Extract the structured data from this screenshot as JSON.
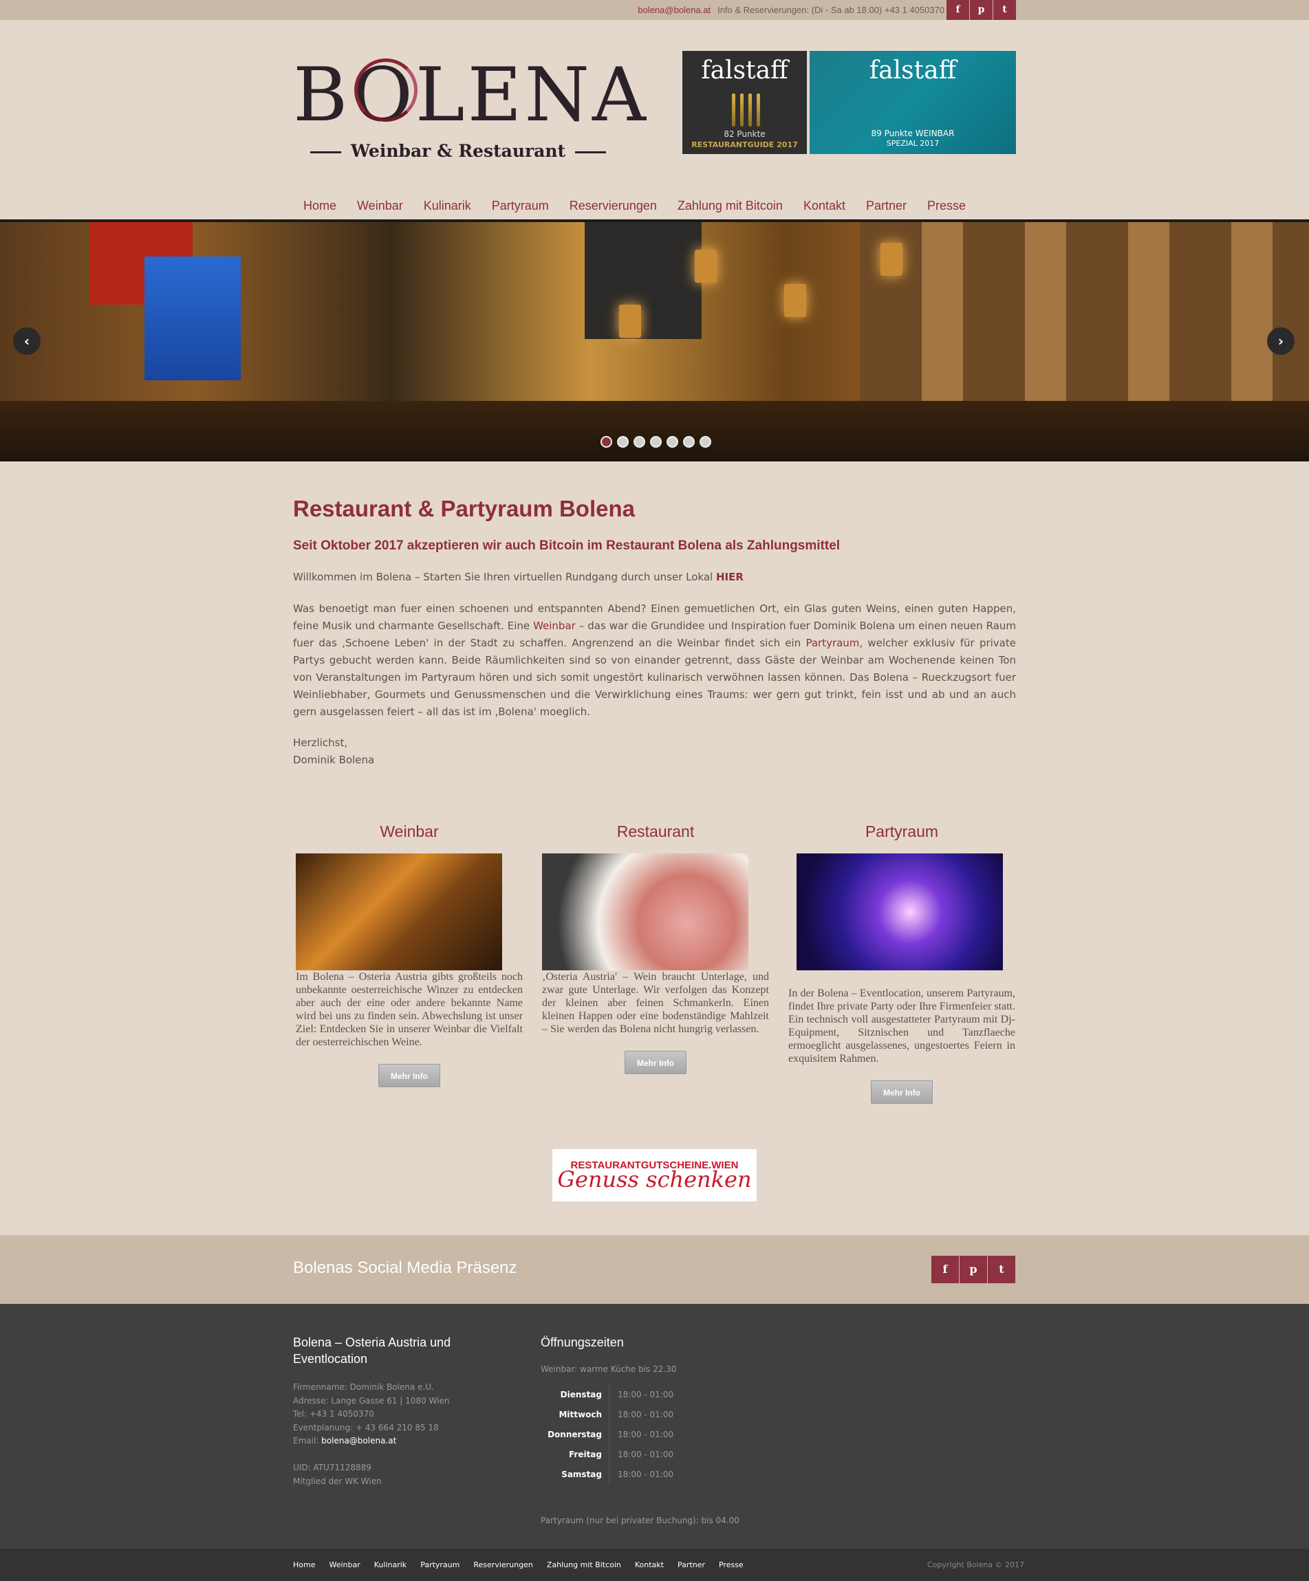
{
  "topbar": {
    "email": "bolena@bolena.at",
    "contact": "Info & Reservierungen: (Di - Sa ab 18.00) +43 1 4050370",
    "social": [
      {
        "icon": "facebook-icon",
        "glyph": "f"
      },
      {
        "icon": "pinterest-icon",
        "glyph": "p"
      },
      {
        "icon": "twitter-icon",
        "glyph": "t"
      }
    ]
  },
  "logo": {
    "word": "BOLENA",
    "subtitle": "Weinbar & Restaurant"
  },
  "badges": {
    "falstaff1": {
      "title": "falstaff",
      "points": "82 Punkte",
      "guide": "RESTAURANTGUIDE 2017"
    },
    "falstaff2": {
      "title": "falstaff",
      "points": "89 Punkte  WEINBAR",
      "guide": "SPEZIAL 2017"
    }
  },
  "nav": [
    "Home",
    "Weinbar",
    "Kulinarik",
    "Partyraum",
    "Reservierungen",
    "Zahlung mit Bitcoin",
    "Kontakt",
    "Partner",
    "Presse"
  ],
  "slider": {
    "prev": "‹",
    "next": "›",
    "dots": 7,
    "active_dot": 0
  },
  "content": {
    "title": "Restaurant & Partyraum Bolena",
    "subtitle": "Seit Oktober 2017 akzeptieren wir auch Bitcoin im Restaurant Bolena als Zahlungsmittel",
    "welcome": "Willkommen im Bolena – Starten Sie Ihren virtuellen Rundgang durch unser Lokal ",
    "welcome_link": "HIER",
    "intro_1": "Was benoetigt man fuer einen schoenen und entspannten Abend? Einen gemuetlichen Ort, ein Glas guten Weins, einen guten Happen, feine Musik und charmante Gesellschaft. Eine ",
    "intro_link1": "Weinbar",
    "intro_2": " – das war die Grundidee und Inspiration fuer Dominik Bolena um einen neuen Raum fuer das ‚Schoene Leben' in der Stadt zu schaffen. Angrenzend an die Weinbar findet sich ein ",
    "intro_link2": "Partyraum",
    "intro_3": ", welcher exklusiv für private Partys gebucht werden kann. Beide Räumlichkeiten sind so von einander getrennt, dass Gäste der Weinbar am Wochenende keinen Ton von Veranstaltungen im Partyraum hören und sich somit ungestört kulinarisch verwöhnen lassen können. Das Bolena – Rueckzugsort fuer Weinliebhaber, Gourmets und Genussmenschen und die Verwirklichung eines Traums: wer gern gut trinkt, fein isst und ab und an auch gern ausgelassen feiert – all das ist im ‚Bolena' moeglich.",
    "greeting": "Herzlichst,",
    "signature": "Dominik Bolena"
  },
  "columns": [
    {
      "title": "Weinbar",
      "text": "Im Bolena – Osteria Austria gibts großteils noch unbekannte oesterreichische Winzer zu entdecken aber auch der eine oder andere bekannte Name wird bei uns zu finden sein. Abwechslung ist unser Ziel: Entdecken Sie in unserer Weinbar die Vielfalt der oesterreichischen Weine.",
      "button": "Mehr Info"
    },
    {
      "title": "Restaurant",
      "text": "‚Osteria Austria' – Wein braucht Unterlage, und zwar gute Unterlage. Wir verfolgen das Konzept der kleinen aber feinen Schmankerln. Einen kleinen Happen oder eine bodenständige Mahlzeit – Sie werden das Bolena nicht hungrig verlassen.",
      "button": "Mehr Info"
    },
    {
      "title": "Partyraum",
      "text": "In der Bolena – Eventlocation, unserem Partyraum, findet Ihre private Party oder Ihre Firmenfeier statt. Ein technisch voll ausgestatteter Partyraum mit Dj-Equipment, Sitznischen und Tanzflaeche ermoeglicht ausgelassenes, ungestoertes Feiern in exquisitem Rahmen.",
      "button": "Mehr Info"
    }
  ],
  "voucher": {
    "top": "RESTAURANTGUTSCHEINE.WIEN",
    "script": "Genuss schenken"
  },
  "social_band": {
    "title": "Bolenas Social Media Präsenz"
  },
  "footer": {
    "left_title": "Bolena – Osteria Austria und Eventlocation",
    "firm": "Firmenname: Dominik Bolena e.U.",
    "address": "Adresse: Lange Gasse 61 | 1080 Wien",
    "tel": "Tel: +43 1 4050370",
    "event": "Eventplanung: + 43 664 210 85 18",
    "email_label": "Email: ",
    "email": "bolena@bolena.at",
    "uid": "UID: ATU71128889",
    "member": "Mitglied der WK Wien",
    "right_title": "Öffnungszeiten",
    "weinbar": "Weinbar: warme Küche bis 22.30",
    "hours": [
      {
        "day": "Dienstag",
        "time": "18:00 - 01:00"
      },
      {
        "day": "Mittwoch",
        "time": "18:00 - 01:00"
      },
      {
        "day": "Donnerstag",
        "time": "18:00 - 01:00"
      },
      {
        "day": "Freitag",
        "time": "18:00 - 01:00"
      },
      {
        "day": "Samstag",
        "time": "18:00 - 01:00"
      }
    ],
    "party": "Partyraum (nur bei privater Buchung): bis 04.00",
    "copyright": "Copyright Bolena © 2017"
  },
  "colors": {
    "accent": "#8f2e3e",
    "background": "#e4d8cc",
    "band": "#c9b9a6",
    "footer": "#404040"
  }
}
